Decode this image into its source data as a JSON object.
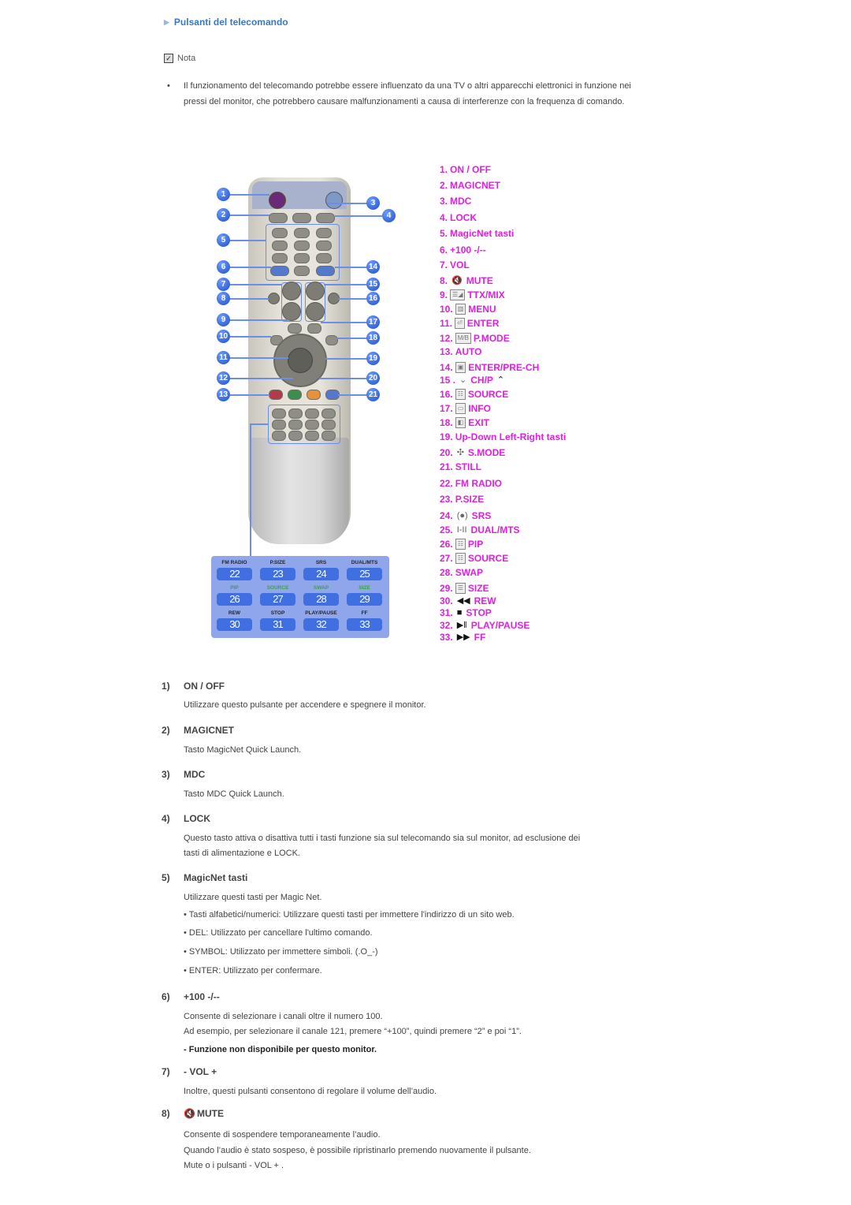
{
  "section_title": "Pulsanti del telecomando",
  "note": {
    "label": "Nota",
    "bullet": "Il funzionamento del telecomando potrebbe essere influenzato da una TV o altri apparecchi elettronici in funzione nei pressi del monitor, che potrebbero causare malfunzionamenti a causa di interferenze con la frequenza di comando."
  },
  "remote": {
    "callouts": [
      "1",
      "2",
      "3",
      "4",
      "5",
      "6",
      "7",
      "8",
      "9",
      "10",
      "11",
      "12",
      "13",
      "14",
      "15",
      "16",
      "17",
      "18",
      "19",
      "20",
      "21"
    ],
    "keypad_labels": [
      "FM RADIO",
      "P.SIZE",
      "SRS",
      "DUAL/MTS",
      "PIP",
      "SOURCE",
      "SWAP",
      "SIZE",
      "REW",
      "STOP",
      "PLAY/PAUSE",
      "FF"
    ],
    "keypad_numbers": [
      "22",
      "23",
      "24",
      "25",
      "26",
      "27",
      "28",
      "29",
      "30",
      "31",
      "32",
      "33"
    ]
  },
  "legend": [
    {
      "num": "1.",
      "icon": "",
      "label": "ON / OFF"
    },
    {
      "num": "2.",
      "icon": "",
      "label": "MAGICNET"
    },
    {
      "num": "3.",
      "icon": "",
      "label": "MDC"
    },
    {
      "num": "4.",
      "icon": "",
      "label": "LOCK"
    },
    {
      "num": "5.",
      "icon": "",
      "label": "MagicNet tasti"
    },
    {
      "num": "6.",
      "icon": "",
      "label": "+100 -/--"
    },
    {
      "num": "7.",
      "icon": "",
      "label": "VOL"
    },
    {
      "num": "8.",
      "icon": "mute-icon",
      "label": "MUTE"
    },
    {
      "num": "9.",
      "icon": "ttx-mix-icon",
      "label": "TTX/MIX"
    },
    {
      "num": "10.",
      "icon": "menu-icon",
      "label": "MENU"
    },
    {
      "num": "11.",
      "icon": "enter-icon",
      "label": "ENTER"
    },
    {
      "num": "12.",
      "icon": "mb-icon",
      "label": "P.MODE"
    },
    {
      "num": "13.",
      "icon": "",
      "label": "AUTO"
    },
    {
      "num": "14.",
      "icon": "pre-ch-icon",
      "label": "ENTER/PRE-CH"
    },
    {
      "num": "15 .",
      "icon": "chevron-down-icon",
      "label": "CH/P"
    },
    {
      "num": "16.",
      "icon": "source-icon",
      "label": "SOURCE"
    },
    {
      "num": "17.",
      "icon": "info-icon",
      "label": "INFO"
    },
    {
      "num": "18.",
      "icon": "exit-icon",
      "label": "EXIT"
    },
    {
      "num": "19.",
      "icon": "",
      "label": "Up-Down Left-Right tasti"
    },
    {
      "num": "20.",
      "icon": "s-mode-icon",
      "label": "S.MODE"
    },
    {
      "num": "21.",
      "icon": "",
      "label": "STILL"
    },
    {
      "num": "22.",
      "icon": "",
      "label": "FM RADIO"
    },
    {
      "num": "23.",
      "icon": "",
      "label": "P.SIZE"
    },
    {
      "num": "24.",
      "icon": "srs-icon",
      "label": "SRS"
    },
    {
      "num": "25.",
      "icon": "dual-icon",
      "label": "DUAL/MTS"
    },
    {
      "num": "26.",
      "icon": "pip-icon",
      "label": "PIP"
    },
    {
      "num": "27.",
      "icon": "source-icon",
      "label": "SOURCE"
    },
    {
      "num": "28.",
      "icon": "",
      "label": "SWAP"
    },
    {
      "num": "29.",
      "icon": "size-icon",
      "label": "SIZE"
    },
    {
      "num": "30.",
      "icon": "rewind-icon",
      "label": "REW"
    },
    {
      "num": "31.",
      "icon": "stop-icon",
      "label": "STOP"
    },
    {
      "num": "32.",
      "icon": "play-pause-icon",
      "label": "PLAY/PAUSE"
    },
    {
      "num": "33.",
      "icon": "fast-forward-icon",
      "label": "FF"
    }
  ],
  "icon_glyphs": {
    "mute-icon": "🔇",
    "ttx-mix-icon": "☰◢",
    "menu-icon": "▥",
    "enter-icon": "⏎",
    "mb-icon": "M/B",
    "pre-ch-icon": "▣",
    "chevron-down-icon": "⌄",
    "chevron-up-icon": "⌃",
    "source-icon": "☷",
    "info-icon": "▭",
    "exit-icon": "◧",
    "s-mode-icon": "✣",
    "srs-icon": "(●)",
    "dual-icon": "I-II",
    "pip-icon": "☷",
    "size-icon": "☰",
    "rewind-icon": "◀◀",
    "stop-icon": "■",
    "play-pause-icon": "▶‖",
    "fast-forward-icon": "▶▶"
  },
  "descriptions": [
    {
      "num": "1)",
      "title": "ON / OFF",
      "lines": [
        "Utilizzare questo pulsante per accendere e spegnere il monitor."
      ]
    },
    {
      "num": "2)",
      "title": "MAGICNET",
      "lines": [
        "Tasto MagicNet Quick Launch."
      ]
    },
    {
      "num": "3)",
      "title": "MDC",
      "lines": [
        "Tasto MDC Quick Launch."
      ]
    },
    {
      "num": "4)",
      "title": "LOCK",
      "lines": [
        "Questo tasto attiva o disattiva tutti i tasti funzione sia sul telecomando sia sul monitor, ad esclusione dei",
        "tasti di alimentazione e LOCK."
      ]
    },
    {
      "num": "5)",
      "title": "MagicNet tasti",
      "lines": [
        "Utilizzare questi tasti per Magic Net.",
        "• Tasti alfabetici/numerici: Utilizzare questi tasti per immettere l'indirizzo di un sito web.",
        "• DEL: Utilizzato per cancellare l'ultimo comando.",
        "• SYMBOL: Utilizzato per immettere simboli. (.O_-)",
        "• ENTER: Utilizzato per confermare."
      ]
    },
    {
      "num": "6)",
      "title": "+100 -/--",
      "lines": [
        "Consente di selezionare i canali oltre il numero 100.",
        "Ad esempio, per selezionare il canale 121, premere “+100”, quindi premere “2” e poi “1”."
      ],
      "bold_line": "- Funzione non disponibile per questo monitor."
    },
    {
      "num": "7)",
      "title": "- VOL +",
      "lines": [
        "Inoltre, questi pulsanti consentono di regolare il volume dell’audio."
      ]
    },
    {
      "num": "8)",
      "title": "MUTE",
      "lines": [
        "Consente di sospendere temporaneamente l’audio.",
        "Quando l’audio è stato sospeso, è possibile ripristinarlo premendo nuovamente il pulsante.",
        "Mute o i pulsanti - VOL + ."
      ]
    }
  ]
}
